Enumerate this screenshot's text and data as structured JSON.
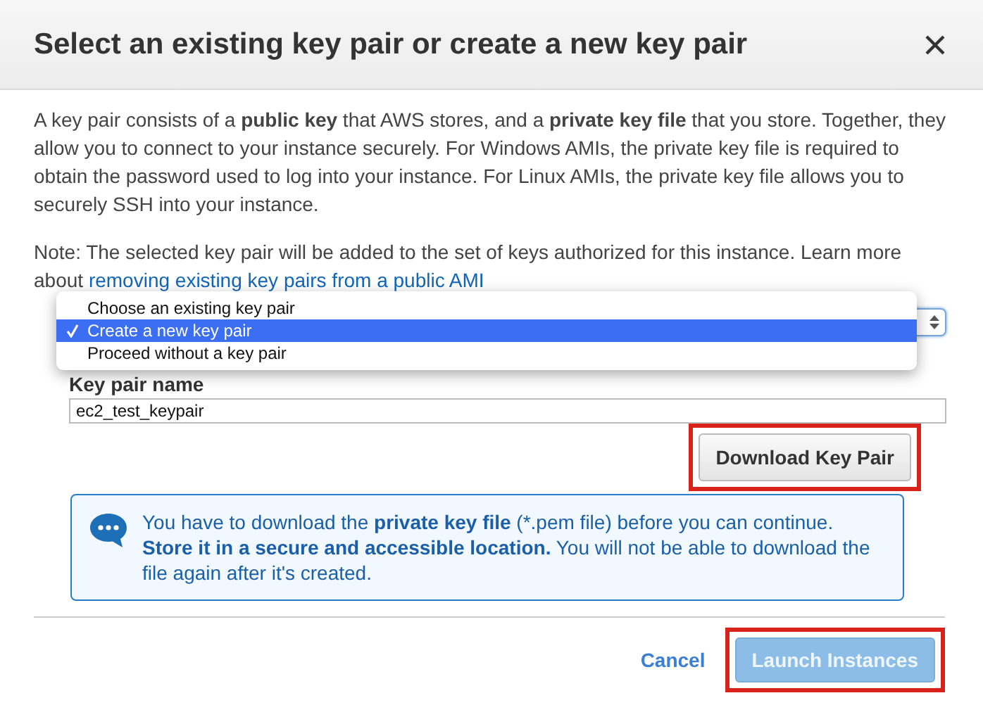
{
  "dialog": {
    "title": "Select an existing key pair or create a new key pair"
  },
  "intro": "A key pair consists of a **public key** that AWS stores, and a **private key file** that you store. Together, they allow you to connect to your instance securely. For Windows AMIs, the private key file is required to obtain the password used to log into your instance. For Linux AMIs, the private key file allows you to securely SSH into your instance.",
  "note": {
    "text": "Note: The selected key pair will be added to the set of keys authorized for this instance. Learn more about",
    "link": "removing existing key pairs from a public AMI"
  },
  "key_pair_select": {
    "expanded": true,
    "options": [
      {
        "label": "Choose an existing key pair",
        "selected": false
      },
      {
        "label": "Create a new key pair",
        "selected": true
      },
      {
        "label": "Proceed without a key pair",
        "selected": false
      }
    ]
  },
  "key_pair_name": {
    "label": "Key pair name",
    "value": "ec2_test_keypair"
  },
  "download_button": {
    "label": "Download Key Pair",
    "highlighted": true
  },
  "info": "You have to download the **private key file** (*.pem file) before you can continue. **Store it in a secure and accessible location.** You will not be able to download the file again after it's created.",
  "footer": {
    "cancel": "Cancel",
    "launch": {
      "label": "Launch Instances",
      "disabled": true,
      "highlighted": true
    }
  }
}
